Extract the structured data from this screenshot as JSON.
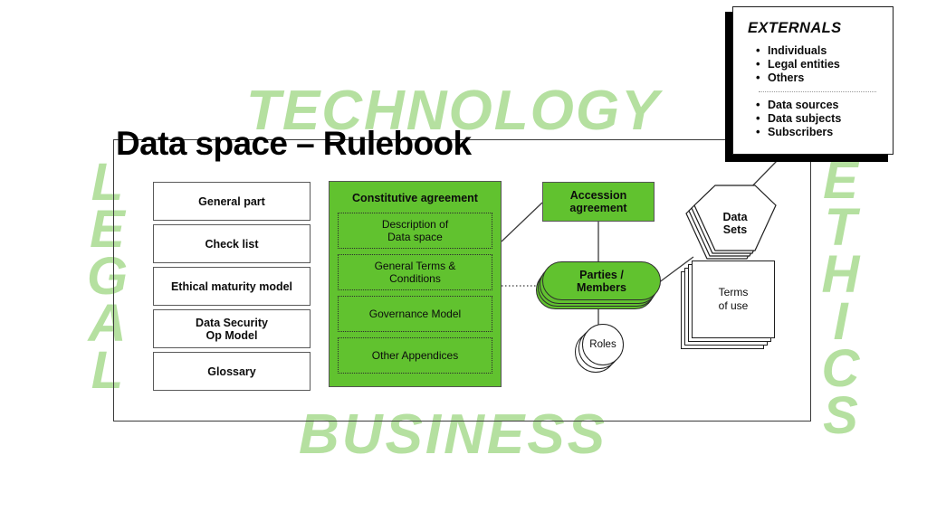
{
  "title": "Data space – Rulebook",
  "colors": {
    "green": "#61c22f",
    "watermark_green": "#b5e0a0",
    "line": "#3a3a3a",
    "text": "#0c0c0c"
  },
  "watermarks": {
    "technology": "TECHNOLOGY",
    "business": "BUSINESS",
    "legal": "L\nE\nG\nA\nL",
    "ethics": "E\nT\nH\nI\nC\nS"
  },
  "left_column": {
    "items": [
      {
        "label": "General part"
      },
      {
        "label": "Check list"
      },
      {
        "label": "Ethical maturity model"
      },
      {
        "label": "Data Security\nOp Model"
      },
      {
        "label": "Glossary"
      }
    ]
  },
  "constitutive_agreement": {
    "title": "Constitutive agreement",
    "items": [
      {
        "label": "Description of\nData space"
      },
      {
        "label": "General Terms &\nConditions"
      },
      {
        "label": "Governance Model"
      },
      {
        "label": "Other Appendices"
      }
    ]
  },
  "accession_agreement": {
    "label": "Accession\nagreement"
  },
  "parties": {
    "label": "Parties /\nMembers"
  },
  "roles": {
    "label": "Roles"
  },
  "data_sets": {
    "label": "Data\nSets"
  },
  "terms_of_use": {
    "label": "Terms\nof use"
  },
  "externals": {
    "title": "EXTERNALS",
    "group_one": [
      "Individuals",
      "Legal entities",
      "Others"
    ],
    "group_two": [
      "Data sources",
      "Data subjects",
      "Subscribers"
    ]
  }
}
